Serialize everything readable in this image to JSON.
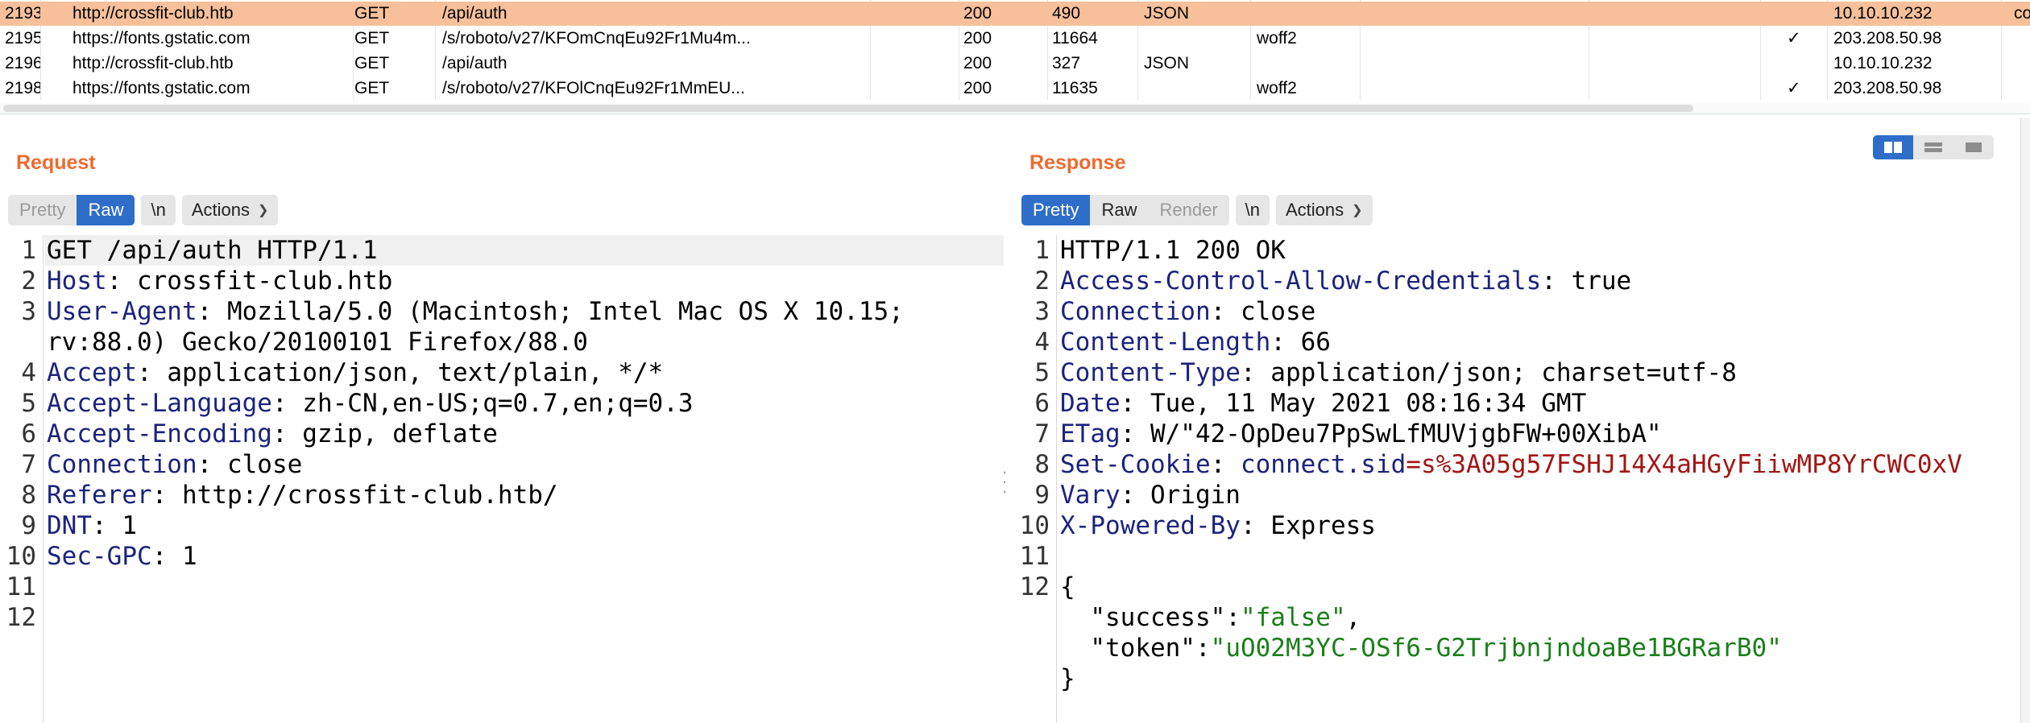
{
  "history": {
    "rows": [
      {
        "num": "2193",
        "host": "http://crossfit-club.htb",
        "method": "GET",
        "url": "/api/auth",
        "status": "200",
        "length": "490",
        "mime": "JSON",
        "ext": "",
        "tls": "",
        "ip": "10.10.10.232",
        "extra": "co",
        "selected": true
      },
      {
        "num": "2195",
        "host": "https://fonts.gstatic.com",
        "method": "GET",
        "url": "/s/roboto/v27/KFOmCnqEu92Fr1Mu4m...",
        "status": "200",
        "length": "11664",
        "mime": "",
        "ext": "woff2",
        "tls": "✓",
        "ip": "203.208.50.98",
        "extra": "",
        "selected": false
      },
      {
        "num": "2196",
        "host": "http://crossfit-club.htb",
        "method": "GET",
        "url": "/api/auth",
        "status": "200",
        "length": "327",
        "mime": "JSON",
        "ext": "",
        "tls": "",
        "ip": "10.10.10.232",
        "extra": "",
        "selected": false
      },
      {
        "num": "2198",
        "host": "https://fonts.gstatic.com",
        "method": "GET",
        "url": "/s/roboto/v27/KFOlCnqEu92Fr1MmEU...",
        "status": "200",
        "length": "11635",
        "mime": "",
        "ext": "woff2",
        "tls": "✓",
        "ip": "203.208.50.98",
        "extra": "",
        "selected": false
      }
    ]
  },
  "request": {
    "title": "Request",
    "view_tabs": [
      "Pretty",
      "Raw"
    ],
    "newline_label": "\\n",
    "actions_label": "Actions",
    "line_numbers": [
      "1",
      "2",
      "3",
      "",
      "4",
      "5",
      "6",
      "7",
      "8",
      "9",
      "10",
      "11",
      "12"
    ],
    "lines": [
      {
        "key": "",
        "sep": "",
        "val": "GET /api/auth HTTP/1.1"
      },
      {
        "key": "Host",
        "sep": ": ",
        "val": "crossfit-club.htb"
      },
      {
        "key": "User-Agent",
        "sep": ": ",
        "val": "Mozilla/5.0 (Macintosh; Intel Mac OS X 10.15;"
      },
      {
        "key": "",
        "sep": "",
        "val": "rv:88.0) Gecko/20100101 Firefox/88.0"
      },
      {
        "key": "Accept",
        "sep": ": ",
        "val": "application/json, text/plain, */*"
      },
      {
        "key": "Accept-Language",
        "sep": ": ",
        "val": "zh-CN,en-US;q=0.7,en;q=0.3"
      },
      {
        "key": "Accept-Encoding",
        "sep": ": ",
        "val": "gzip, deflate"
      },
      {
        "key": "Connection",
        "sep": ": ",
        "val": "close"
      },
      {
        "key": "Referer",
        "sep": ": ",
        "val": "http://crossfit-club.htb/"
      },
      {
        "key": "DNT",
        "sep": ": ",
        "val": "1"
      },
      {
        "key": "Sec-GPC",
        "sep": ": ",
        "val": "1"
      },
      {
        "key": "",
        "sep": "",
        "val": ""
      },
      {
        "key": "",
        "sep": "",
        "val": ""
      }
    ]
  },
  "response": {
    "title": "Response",
    "view_tabs": [
      "Pretty",
      "Raw",
      "Render"
    ],
    "newline_label": "\\n",
    "actions_label": "Actions",
    "line_numbers": [
      "1",
      "2",
      "3",
      "4",
      "5",
      "6",
      "7",
      "8",
      "9",
      "10",
      "11",
      "12",
      "",
      "",
      ""
    ],
    "status_line": "HTTP/1.1 200 OK",
    "headers": [
      {
        "key": "Access-Control-Allow-Credentials",
        "val": "true"
      },
      {
        "key": "Connection",
        "val": "close"
      },
      {
        "key": "Content-Length",
        "val": "66"
      },
      {
        "key": "Content-Type",
        "val": "application/json; charset=utf-8"
      },
      {
        "key": "Date",
        "val": "Tue, 11 May 2021 08:16:34 GMT"
      },
      {
        "key": "ETag",
        "val": "W/\"42-OpDeu7PpSwLfMUVjgbFW+00XibA\""
      }
    ],
    "cookie": {
      "key": "Set-Cookie",
      "name": "connect.sid",
      "value": "s%3A05g57FSHJ14X4aHGyFiiwMP8YrCWC0xV"
    },
    "headers_after": [
      {
        "key": "Vary",
        "val": "Origin"
      },
      {
        "key": "X-Powered-By",
        "val": "Express"
      }
    ],
    "body": {
      "open": "{",
      "success_key": "\"success\"",
      "success_val": "\"false\"",
      "token_key": "\"token\"",
      "token_val": "\"uO02M3YC-OSf6-G2TrjbnjndoaBe1BGRarB0\"",
      "close": "}"
    }
  },
  "colors": {
    "selected_row": "#f7c09a",
    "accent": "#ee6a2f",
    "active_tab": "#2f6ec8",
    "header_key": "#1a237e",
    "cookie_value": "#a31515",
    "json_string": "#1a7f1a"
  },
  "icons": [
    "split-vertical-icon",
    "split-horizontal-icon",
    "single-pane-icon",
    "chevron-down-icon",
    "checkmark-icon",
    "drag-handle-icon"
  ]
}
